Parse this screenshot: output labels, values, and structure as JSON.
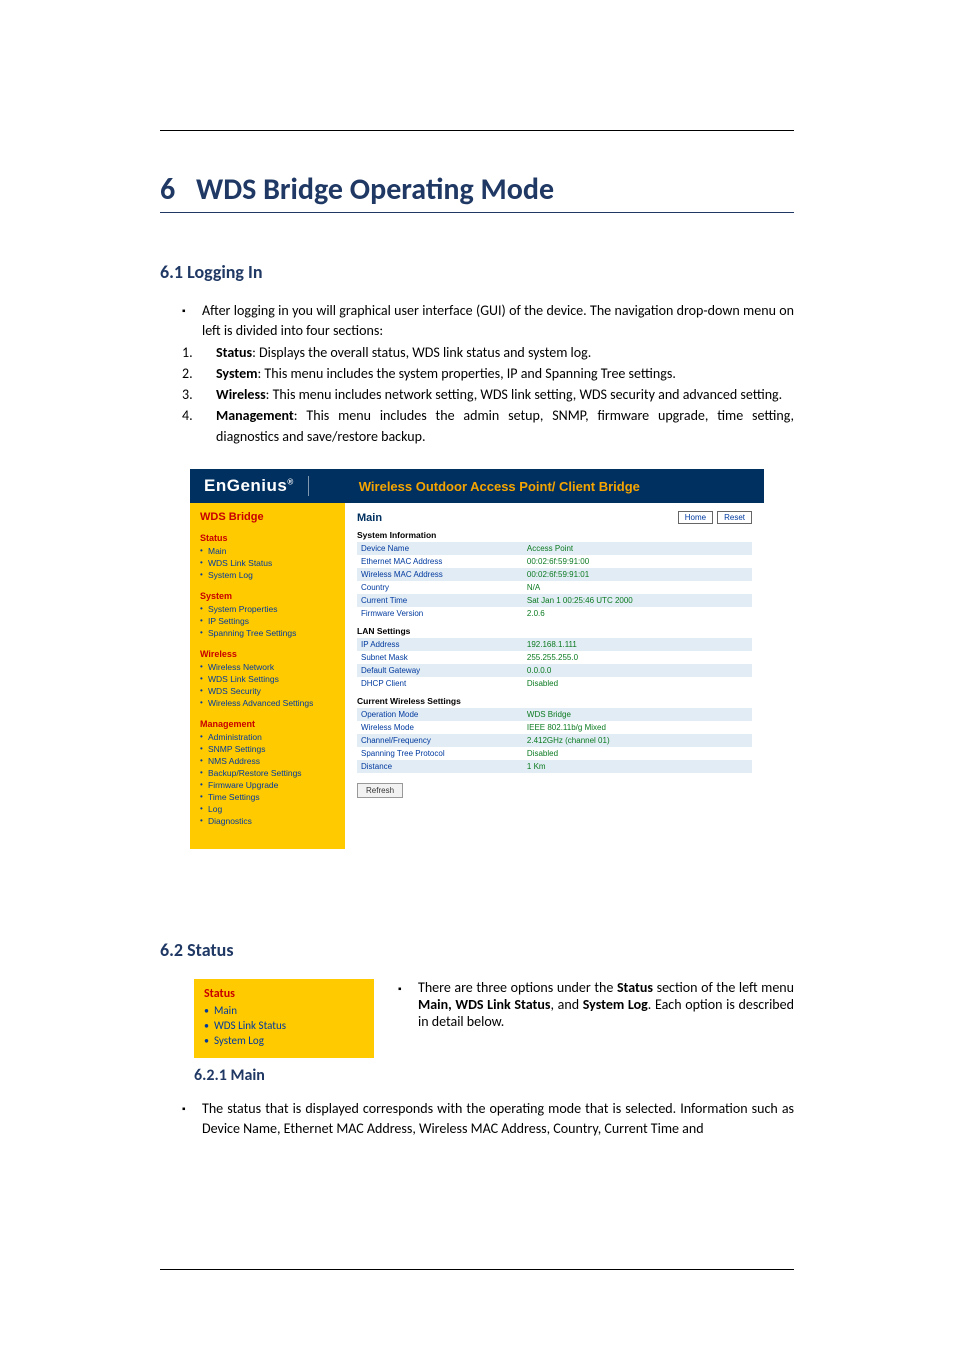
{
  "chapter": {
    "number": "6",
    "title": "WDS Bridge Operating Mode"
  },
  "section61": {
    "heading": "6.1 Logging In",
    "intro": "After logging in you will graphical user interface (GUI) of the device. The navigation drop-down menu on left is divided into four sections:",
    "items": [
      {
        "n": "1.",
        "b": "Status",
        "t": ": Displays the overall status, WDS link status and system log."
      },
      {
        "n": "2.",
        "b": "System",
        "t": ": This menu includes the system properties, IP and Spanning Tree settings."
      },
      {
        "n": "3.",
        "b": "Wireless",
        "t": ": This menu includes network setting, WDS link setting, WDS security and advanced setting."
      },
      {
        "n": "4.",
        "b": "Management",
        "t": ": This menu includes the admin setup, SNMP, firmware upgrade, time setting, diagnostics and save/restore backup."
      }
    ]
  },
  "app": {
    "brand": "EnGenius",
    "brand_sup": "®",
    "tagline": "Wireless Outdoor Access Point/ Client Bridge",
    "mode": "WDS Bridge",
    "content_title": "Main",
    "btn_home": "Home",
    "btn_reset": "Reset",
    "btn_refresh": "Refresh",
    "nav": [
      {
        "head": "Status",
        "items": [
          "Main",
          "WDS Link Status",
          "System Log"
        ]
      },
      {
        "head": "System",
        "items": [
          "System Properties",
          "IP Settings",
          "Spanning Tree Settings"
        ]
      },
      {
        "head": "Wireless",
        "items": [
          "Wireless Network",
          "WDS Link Settings",
          "WDS Security",
          "Wireless Advanced Settings"
        ]
      },
      {
        "head": "Management",
        "items": [
          "Administration",
          "SNMP Settings",
          "NMS Address",
          "Backup/Restore Settings",
          "Firmware Upgrade",
          "Time Settings",
          "Log",
          "Diagnostics"
        ]
      }
    ],
    "tables": [
      {
        "label": "System Information",
        "rows": [
          {
            "k": "Device Name",
            "v": "Access Point"
          },
          {
            "k": "Ethernet MAC Address",
            "v": "00:02:6f:59:91:00"
          },
          {
            "k": "Wireless MAC Address",
            "v": "00:02:6f:59:91:01"
          },
          {
            "k": "Country",
            "v": "N/A"
          },
          {
            "k": "Current Time",
            "v": "Sat Jan 1 00:25:46 UTC 2000"
          },
          {
            "k": "Firmware Version",
            "v": "2.0.6"
          }
        ]
      },
      {
        "label": "LAN Settings",
        "rows": [
          {
            "k": "IP Address",
            "v": "192.168.1.111"
          },
          {
            "k": "Subnet Mask",
            "v": "255.255.255.0"
          },
          {
            "k": "Default Gateway",
            "v": "0.0.0.0"
          },
          {
            "k": "DHCP Client",
            "v": "Disabled"
          }
        ]
      },
      {
        "label": "Current Wireless Settings",
        "rows": [
          {
            "k": "Operation Mode",
            "v": "WDS Bridge"
          },
          {
            "k": "Wireless Mode",
            "v": "IEEE 802.11b/g Mixed"
          },
          {
            "k": "Channel/Frequency",
            "v": "2.412GHz (channel 01)"
          },
          {
            "k": "Spanning Tree Protocol",
            "v": "Disabled"
          },
          {
            "k": "Distance",
            "v": "1 Km"
          }
        ]
      }
    ]
  },
  "section62": {
    "heading": "6.2 Status",
    "snip_head": "Status",
    "snip_items": [
      "Main",
      "WDS Link Status",
      "System Log"
    ],
    "right_pre": "There are three options under the ",
    "right_b1": "Status",
    "right_mid": " section of the left menu ",
    "right_b2": "Main, WDS Link Status",
    "right_mid2": ", and ",
    "right_b3": "System Log",
    "right_post": ". Each option is described in detail below.",
    "sub_heading": "6.2.1   Main",
    "sub_text": "The status that is displayed corresponds with the operating mode that is selected. Information such as Device Name, Ethernet MAC Address, Wireless MAC Address, Country, Current Time and"
  }
}
